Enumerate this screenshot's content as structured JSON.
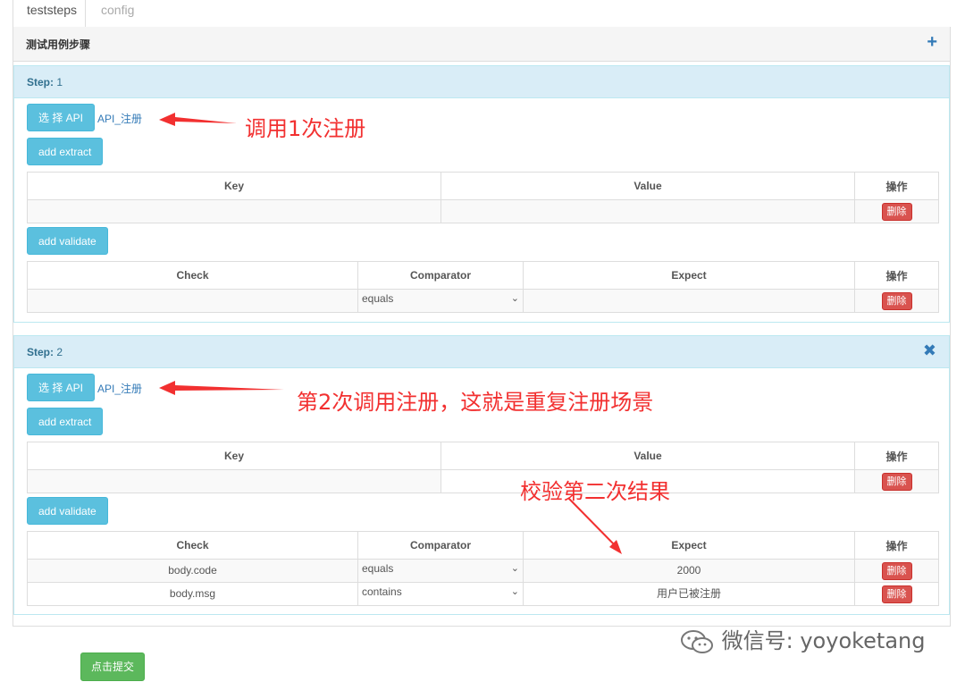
{
  "tabs": [
    "teststeps",
    "config"
  ],
  "section": {
    "title": "测试用例步骤",
    "add_icon": "+"
  },
  "steps": [
    {
      "label": "Step:",
      "number": "1",
      "select_api": "选 择 API",
      "api_name": "API_注册",
      "add_extract": "add extract",
      "extract_headers": [
        "Key",
        "Value",
        "操作"
      ],
      "add_validate": "add validate",
      "validate_headers": [
        "Check",
        "Comparator",
        "Expect",
        "操作"
      ],
      "validate_rows": [
        {
          "check": "",
          "comparator": "equals",
          "expect": ""
        }
      ]
    },
    {
      "label": "Step:",
      "number": "2",
      "select_api": "选 择 API",
      "api_name": "API_注册",
      "add_extract": "add extract",
      "extract_headers": [
        "Key",
        "Value",
        "操作"
      ],
      "add_validate": "add validate",
      "validate_headers": [
        "Check",
        "Comparator",
        "Expect",
        "操作"
      ],
      "validate_rows": [
        {
          "check": "body.code",
          "comparator": "equals",
          "expect": "2000"
        },
        {
          "check": "body.msg",
          "comparator": "contains",
          "expect": "用户已被注册"
        }
      ]
    }
  ],
  "delete_label": "删除",
  "submit_label": "点击提交",
  "annotations": {
    "a1": "调用1次注册",
    "a2": "第2次调用注册，这就是重复注册场景",
    "a3": "校验第二次结果"
  },
  "watermark": "微信号: yoyoketang",
  "colors": {
    "info": "#5bc0de",
    "danger": "#d9534f",
    "success": "#5cb85c",
    "annotation": "#f23030",
    "panel_head": "#d9edf7"
  },
  "icons": {
    "close": "close-icon",
    "add": "plus-icon",
    "arrow": "red-arrow",
    "dropdown": "chevron-down-icon"
  }
}
